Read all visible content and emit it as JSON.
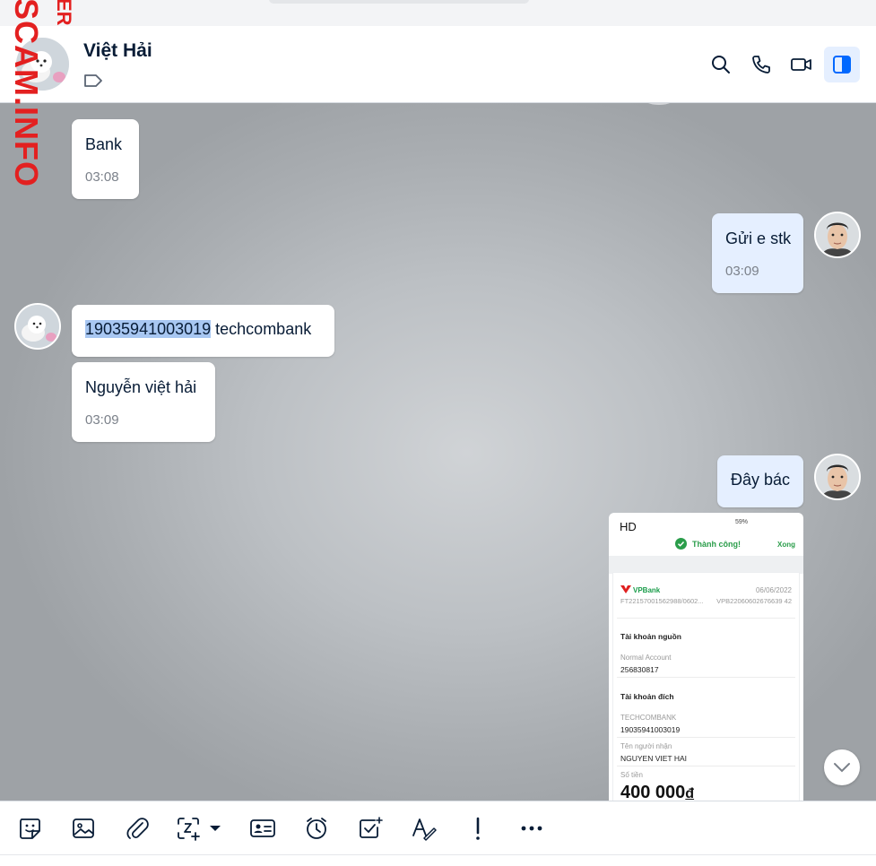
{
  "header": {
    "contact_name": "Việt Hải"
  },
  "messages": [
    {
      "id": "m1",
      "side": "left",
      "text": "Bank",
      "time": "03:08"
    },
    {
      "id": "m2",
      "side": "right",
      "text": "Gửi e stk",
      "time": "03:09"
    },
    {
      "id": "m3",
      "side": "left",
      "text_selected": "19035941003019",
      "text_rest": " techcombank"
    },
    {
      "id": "m4",
      "side": "left",
      "text": "Nguyễn việt hải",
      "time": "03:09"
    },
    {
      "id": "m5",
      "side": "right",
      "text": "Đây bác"
    }
  ],
  "receipt": {
    "quality": "HD",
    "status_bar": "59%",
    "success_text": "Thành công!",
    "done_text": "Xong",
    "bank_logo": "VPBank",
    "date": "06/06/2022",
    "ref1": "FT22157001562988/0602...",
    "ref2": "VPB22060602676639 42",
    "source_heading": "Tài khoản nguồn",
    "source_type": "Normal Account",
    "source_number": "256830817",
    "dest_heading": "Tài khoản đích",
    "dest_bank": "TECHCOMBANK",
    "dest_number": "19035941003019",
    "recipient_label": "Tên người nhận",
    "recipient_name": "NGUYEN VIET HAI",
    "amount_label": "Số tiền",
    "amount": "400 000",
    "currency": "đ"
  },
  "watermark": {
    "main": "SCAM.INFO",
    "small": "ER"
  },
  "colors": {
    "accent": "#0068ff",
    "bubble_me": "#e5efff",
    "success": "#2a9d4a",
    "watermark": "#e32020"
  },
  "icons": {
    "header": [
      "search-icon",
      "phone-icon",
      "video-call-icon",
      "sidebar-toggle-icon"
    ],
    "toolbar": [
      "sticker-icon",
      "image-icon",
      "attachment-icon",
      "screenshot-icon",
      "contact-card-icon",
      "reminder-icon",
      "task-icon",
      "text-format-icon",
      "urgent-icon",
      "more-icon"
    ]
  }
}
